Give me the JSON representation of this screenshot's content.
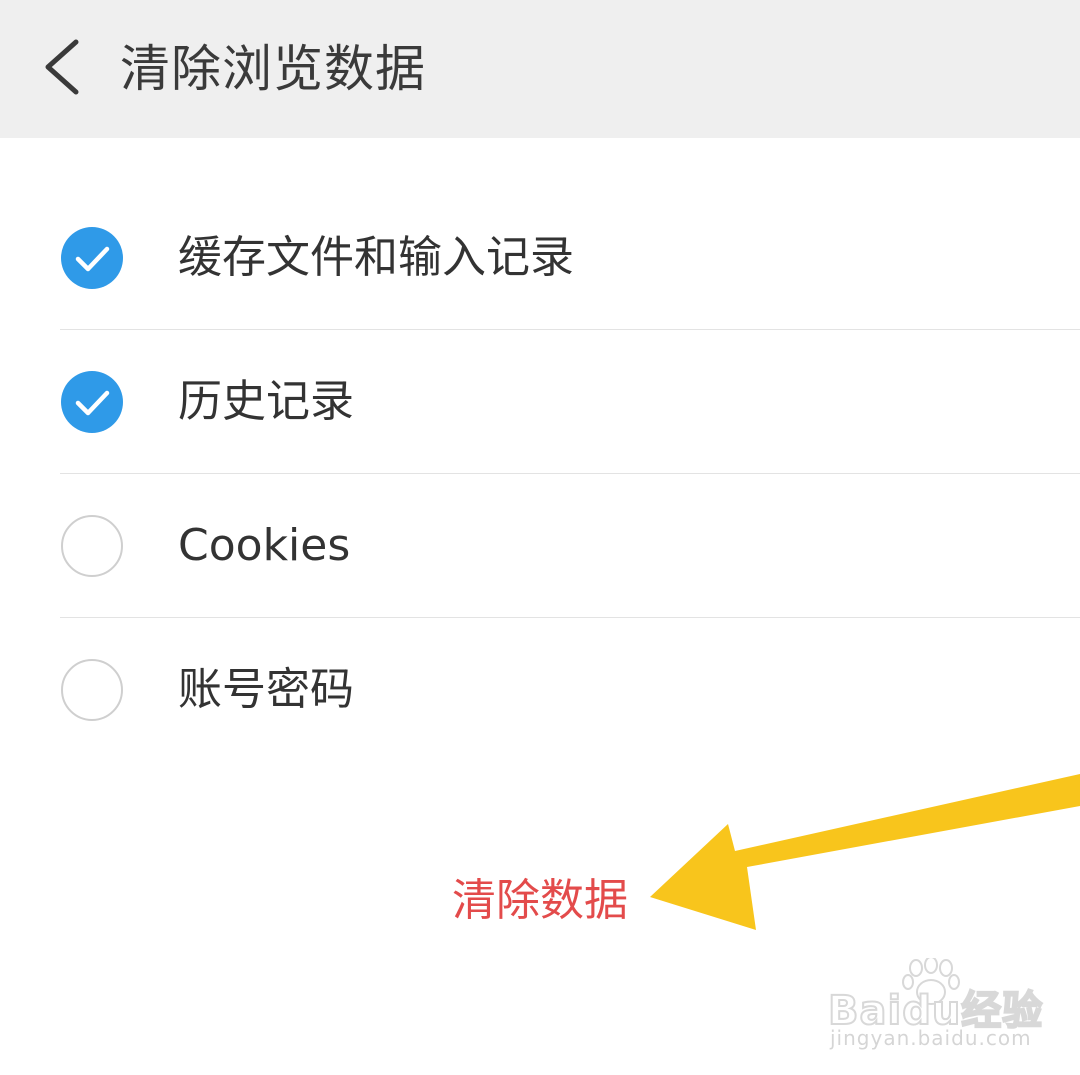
{
  "header": {
    "title": "清除浏览数据",
    "back_icon": "chevron-left-icon"
  },
  "options": [
    {
      "label": "缓存文件和输入记录",
      "checked": true
    },
    {
      "label": "历史记录",
      "checked": true
    },
    {
      "label": "Cookies",
      "checked": false
    },
    {
      "label": "账号密码",
      "checked": false
    }
  ],
  "actions": {
    "clear_label": "清除数据"
  },
  "annotation": {
    "arrow_icon": "arrow-pointer-icon",
    "arrow_color": "#f8c51c"
  },
  "watermark": {
    "brand": "Baidu经验",
    "url": "jingyan.baidu.com"
  },
  "colors": {
    "header_bg": "#efefef",
    "accent": "#2f9ae8",
    "danger": "#e34b4b",
    "text": "#333333",
    "divider": "#e3e3e3"
  }
}
